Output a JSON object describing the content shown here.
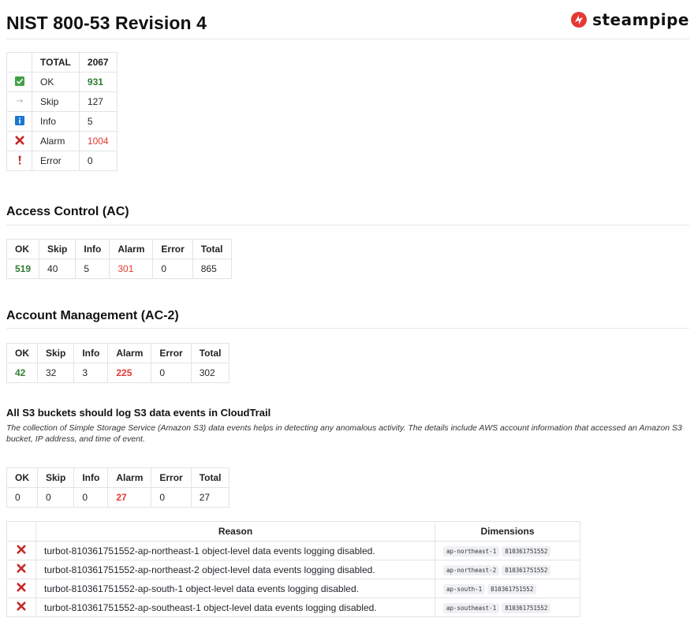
{
  "header": {
    "title": "NIST 800-53 Revision 4",
    "logo_text": "steampipe"
  },
  "summary": {
    "total_label": "TOTAL",
    "total_value": "2067",
    "rows": [
      {
        "icon": "check-icon",
        "label": "OK",
        "value": "931"
      },
      {
        "icon": "skip-arrow-icon",
        "label": "Skip",
        "value": "127"
      },
      {
        "icon": "info-icon",
        "label": "Info",
        "value": "5"
      },
      {
        "icon": "alarm-x-icon",
        "label": "Alarm",
        "value": "1004"
      },
      {
        "icon": "error-exclamation-icon",
        "label": "Error",
        "value": "0"
      }
    ]
  },
  "columns": [
    "OK",
    "Skip",
    "Info",
    "Alarm",
    "Error",
    "Total"
  ],
  "sections": [
    {
      "heading": "Access Control (AC)",
      "values": [
        "519",
        "40",
        "5",
        "301",
        "0",
        "865"
      ]
    },
    {
      "heading": "Account Management (AC-2)",
      "values": [
        "42",
        "32",
        "3",
        "225",
        "0",
        "302"
      ]
    }
  ],
  "control": {
    "heading": "All S3 buckets should log S3 data events in CloudTrail",
    "description": "The collection of Simple Storage Service (Amazon S3) data events helps in detecting any anomalous activity. The details include AWS account information that accessed an Amazon S3 bucket, IP address, and time of event.",
    "values": [
      "0",
      "0",
      "0",
      "27",
      "0",
      "27"
    ]
  },
  "results": {
    "reason_header": "Reason",
    "dimensions_header": "Dimensions",
    "rows": [
      {
        "reason": "turbot-810361751552-ap-northeast-1 object-level data events logging disabled.",
        "dims": [
          "ap-northeast-1",
          "810361751552"
        ]
      },
      {
        "reason": "turbot-810361751552-ap-northeast-2 object-level data events logging disabled.",
        "dims": [
          "ap-northeast-2",
          "810361751552"
        ]
      },
      {
        "reason": "turbot-810361751552-ap-south-1 object-level data events logging disabled.",
        "dims": [
          "ap-south-1",
          "810361751552"
        ]
      },
      {
        "reason": "turbot-810361751552-ap-southeast-1 object-level data events logging disabled.",
        "dims": [
          "ap-southeast-1",
          "810361751552"
        ]
      }
    ]
  },
  "colors": {
    "ok": "#2e7d32",
    "alarm": "#e53935",
    "info": "#1976d2",
    "check_bg": "#43a047"
  }
}
